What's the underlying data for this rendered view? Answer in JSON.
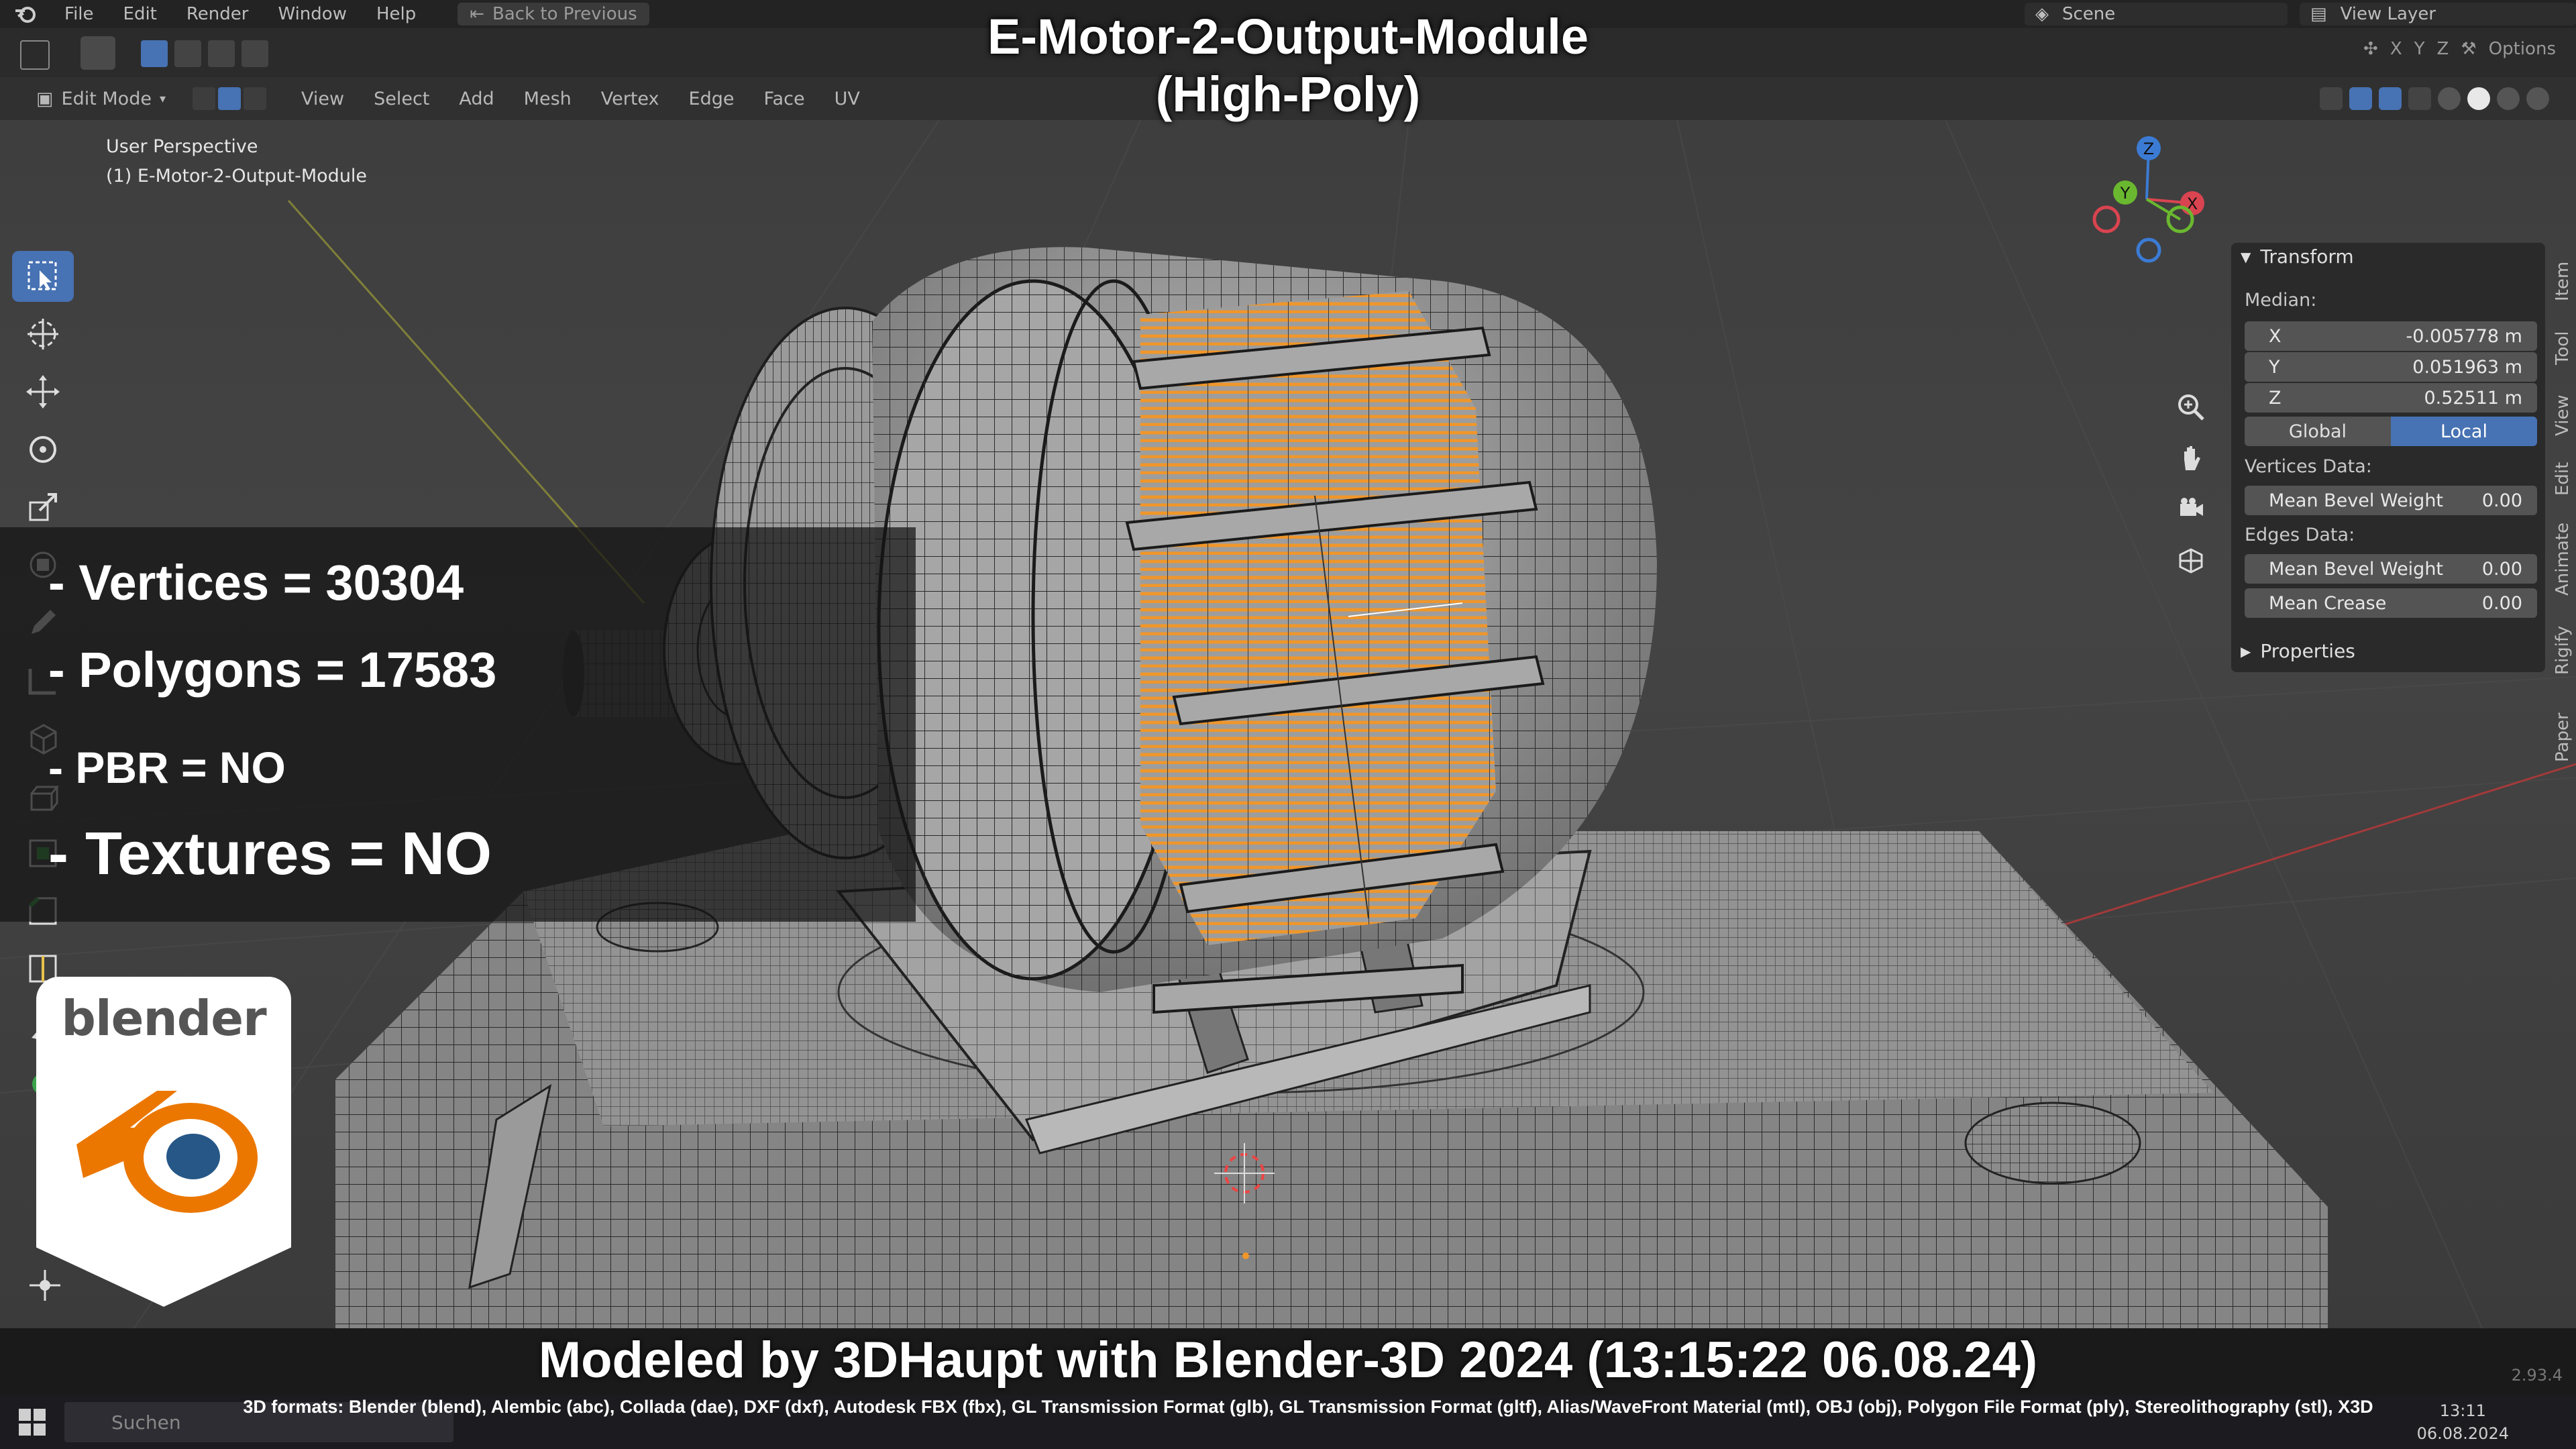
{
  "menubar": {
    "items": [
      "File",
      "Edit",
      "Render",
      "Window",
      "Help"
    ],
    "back_label": "Back to Previous",
    "scene_label": "Scene",
    "view_layer_label": "View Layer"
  },
  "header": {
    "mode_label": "Edit Mode",
    "menus": [
      "View",
      "Select",
      "Add",
      "Mesh",
      "Vertex",
      "Edge",
      "Face",
      "UV"
    ],
    "options_label": "Options"
  },
  "viewport": {
    "perspective_label": "User Perspective",
    "object_label": "(1) E-Motor-2-Output-Module"
  },
  "title": {
    "line1": "E-Motor-2-Output-Module",
    "line2": "(High-Poly)"
  },
  "stats": {
    "vertices": "- Vertices = 30304",
    "polygons": "- Polygons = 17583",
    "pbr": "- PBR =  NO",
    "textures": "- Textures = NO"
  },
  "npanel": {
    "transform_title": "Transform",
    "median_label": "Median:",
    "x_label": "X",
    "x_value": "-0.005778 m",
    "y_label": "Y",
    "y_value": "0.051963 m",
    "z_label": "Z",
    "z_value": "0.52511 m",
    "global_label": "Global",
    "local_label": "Local",
    "vertices_data_label": "Vertices Data:",
    "mean_bevel_weight_label": "Mean Bevel Weight",
    "vert_bevel_value": "0.00",
    "edges_data_label": "Edges Data:",
    "edge_bevel_value": "0.00",
    "mean_crease_label": "Mean Crease",
    "crease_value": "0.00",
    "properties_title": "Properties"
  },
  "side_tabs": [
    "Item",
    "Tool",
    "View",
    "Edit",
    "Animate",
    "Rigify",
    "Paper"
  ],
  "gizmo": {
    "x": "X",
    "y": "Y",
    "z": "Z"
  },
  "logo": {
    "word": "blender"
  },
  "bottom": {
    "credit": "Modeled by 3DHaupt with Blender-3D 2024 (13:15:22  06.08.24)",
    "formats": "3D formats: Blender (blend), Alembic (abc), Collada (dae), DXF (dxf), Autodesk FBX (fbx), GL Transmission Format (glb), GL Transmission Format (gltf), Alias/WaveFront Material (mtl), OBJ (obj), Polygon File Format (ply), Stereolithography (stl), X3D",
    "search_placeholder": "Suchen",
    "time": "13:11",
    "date": "06.08.2024",
    "version": "2.93.4"
  },
  "colors": {
    "accent": "#4772b3",
    "selection": "#f0962a",
    "mesh": "#8a8a8a",
    "wire": "#1a1a1a"
  }
}
